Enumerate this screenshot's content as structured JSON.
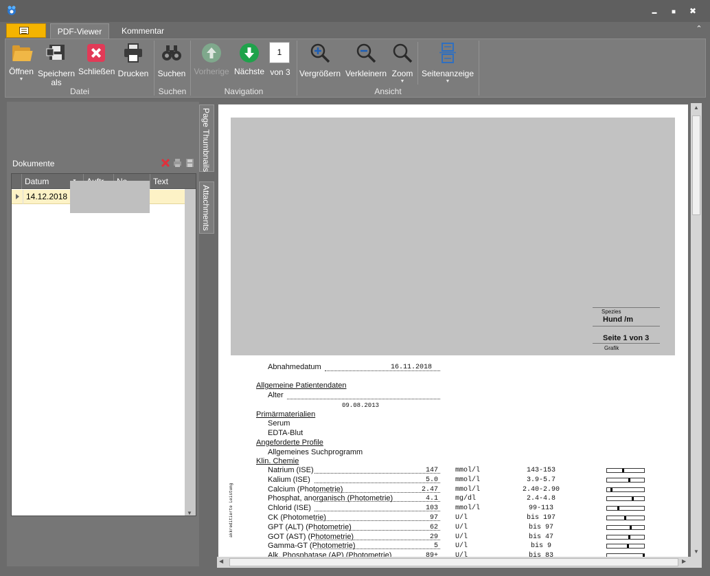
{
  "window": {
    "min_glyph": "▬",
    "max_glyph": "■",
    "close_glyph": "✖"
  },
  "tabs": {
    "pdf_viewer": "PDF-Viewer",
    "comment": "Kommentar",
    "collapse_glyph": "⌃"
  },
  "ribbon": {
    "open": "Öffnen",
    "save_as": "Speichern als",
    "close": "Schließen",
    "print": "Drucken",
    "search": "Suchen",
    "previous": "Vorherige",
    "next": "Nächste",
    "page_number": "1",
    "of_pages": "von 3",
    "zoom_in": "Vergrößern",
    "zoom_out": "Verkleinern",
    "zoom": "Zoom",
    "page_view": "Seitenanzeige",
    "groups": {
      "file": "Datei",
      "search": "Suchen",
      "navigation": "Navigation",
      "view": "Ansicht"
    }
  },
  "documents": {
    "title": "Dokumente",
    "columns": [
      "Datum",
      "Auftr",
      "Na",
      "Text"
    ],
    "rows": [
      {
        "date": "14.12.2018"
      }
    ]
  },
  "side_tabs": {
    "thumbnails": "Page Thumbnails",
    "attachments": "Attachments"
  },
  "pdf": {
    "species_label": "Spezies",
    "species_value": "Hund /m",
    "page_info": "Seite  1 von 3",
    "grafik": "Grafik",
    "sampling_date_label": "Abnahmedatum",
    "sampling_date": "16.11.2018",
    "general_patient_data": "Allgemeine Patientendaten",
    "age_label": "Alter",
    "age_value": "09.08.2013",
    "primary_materials": "Primärmaterialien",
    "material_1": "Serum",
    "material_2": "EDTA-Blut",
    "requested_profiles": "Angeforderte Profile",
    "profile_1": "Allgemeines Suchprogramm",
    "clin_chem": "Klin. Chemie",
    "side_note": "akkreditierte Leistung",
    "lab_results": [
      {
        "name": "Natrium (ISE)",
        "value": "147",
        "unit": "mmol/l",
        "ref": "143-153",
        "marker": 0.42
      },
      {
        "name": "Kalium (ISE)",
        "value": "5.0",
        "unit": "mmol/l",
        "ref": "3.9-5.7",
        "marker": 0.6
      },
      {
        "name": "Calcium (Photometrie)",
        "value": "2.47",
        "unit": "mmol/l",
        "ref": "2.40-2.90",
        "marker": 0.1
      },
      {
        "name": "Phosphat, anorganisch (Photometrie)",
        "value": "4.1",
        "unit": "mg/dl",
        "ref": "2.4-4.8",
        "marker": 0.7
      },
      {
        "name": "Chlorid (ISE)",
        "value": "103",
        "unit": "mmol/l",
        "ref": "99-113",
        "marker": 0.28
      },
      {
        "name": "CK (Photometrie)",
        "value": "97",
        "unit": "U/l",
        "ref": "bis 197",
        "marker": 0.48
      },
      {
        "name": "GPT (ALT) (Photometrie)",
        "value": "62",
        "unit": "U/l",
        "ref": "bis 97",
        "marker": 0.63
      },
      {
        "name": "GOT (AST) (Photometrie)",
        "value": "29",
        "unit": "U/l",
        "ref": "bis 47",
        "marker": 0.6
      },
      {
        "name": "Gamma-GT (Photometrie)",
        "value": "5",
        "unit": "U/l",
        "ref": "bis 9",
        "marker": 0.55
      },
      {
        "name": "Alk. Phosphatase (AP) (Photometrie)",
        "value": "89+",
        "unit": "U/l",
        "ref": "bis 83",
        "marker": 1.0
      }
    ]
  }
}
